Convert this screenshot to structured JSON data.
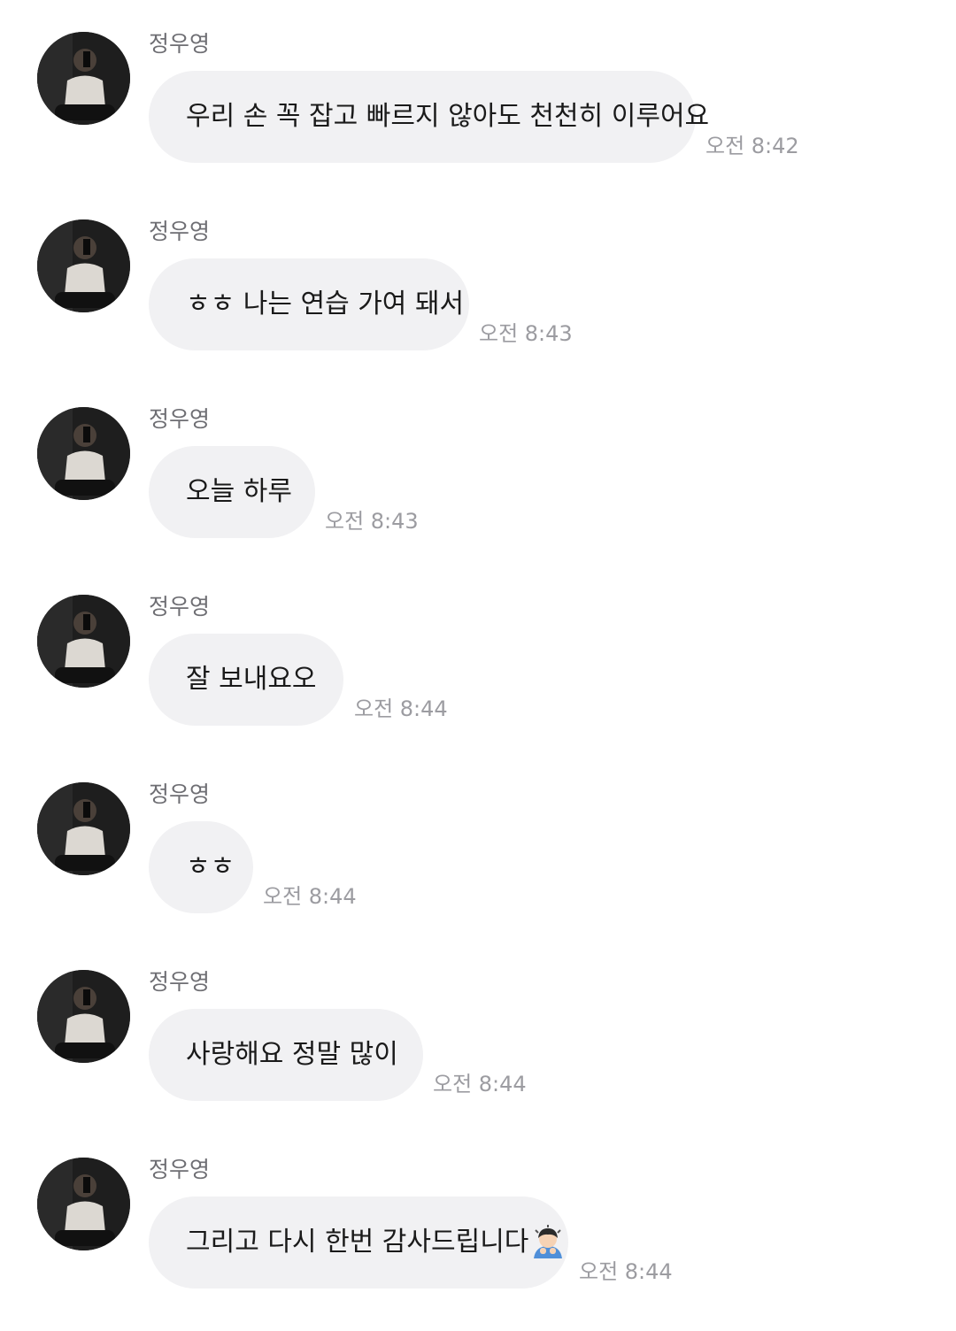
{
  "chat": {
    "messages": [
      {
        "sender": "정우영",
        "text": "우리 손 꼭 잡고 빠르지 않아도 천천히 이루어요",
        "time": "오전 8:42"
      },
      {
        "sender": "정우영",
        "text": "ㅎㅎ 나는 연습 가여 돼서",
        "time": "오전 8:43"
      },
      {
        "sender": "정우영",
        "text": "오늘 하루",
        "time": "오전 8:43"
      },
      {
        "sender": "정우영",
        "text": "잘 보내요오",
        "time": "오전 8:44"
      },
      {
        "sender": "정우영",
        "text": "ㅎㅎ",
        "time": "오전 8:44"
      },
      {
        "sender": "정우영",
        "text": "사랑해요 정말 많이",
        "time": "오전 8:44"
      },
      {
        "sender": "정우영",
        "text": "그리고 다시 한번 감사드립니다",
        "time": "오전 8:44",
        "emoji": "person-bowing-emoji"
      }
    ]
  }
}
